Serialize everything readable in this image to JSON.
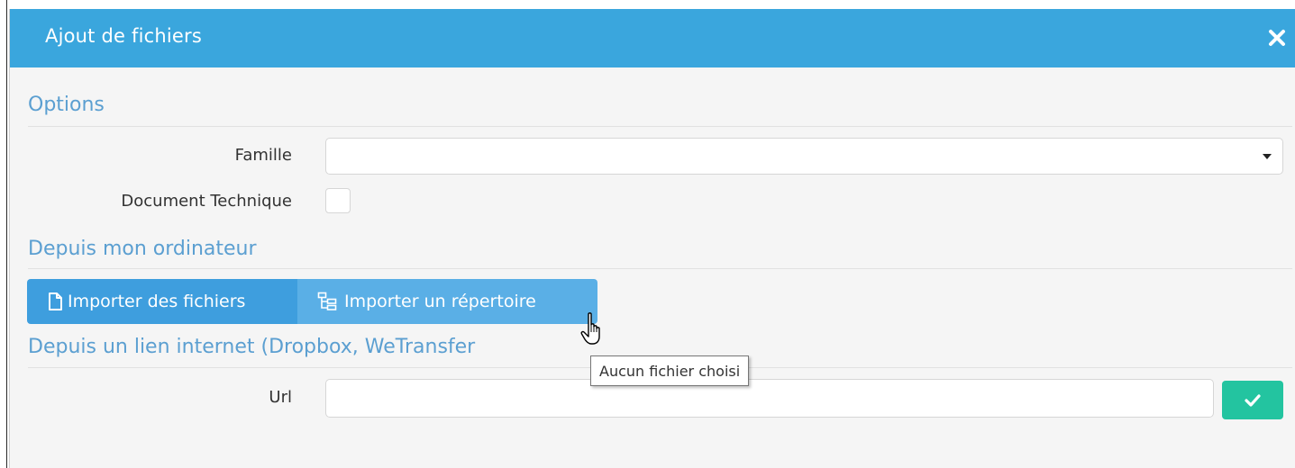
{
  "dialog": {
    "title": "Ajout de fichiers",
    "header_color": "#3aa6dd",
    "close_icon": "close-icon"
  },
  "options": {
    "section_title": "Options",
    "famille_label": "Famille",
    "famille_value": "",
    "document_technique_label": "Document Technique",
    "document_technique_checked": false
  },
  "computer": {
    "section_title": "Depuis mon ordinateur",
    "import_files_label": "Importer des fichiers",
    "import_files_icon": "file-icon",
    "import_dir_label": "Importer un répertoire",
    "import_dir_icon": "folder-tree-icon"
  },
  "internet": {
    "section_title": "Depuis un lien internet (Dropbox, WeTransfer",
    "url_label": "Url",
    "url_value": "",
    "confirm_icon": "check-icon",
    "confirm_color": "#23c4a0"
  },
  "tooltip": {
    "text": "Aucun fichier choisi"
  }
}
